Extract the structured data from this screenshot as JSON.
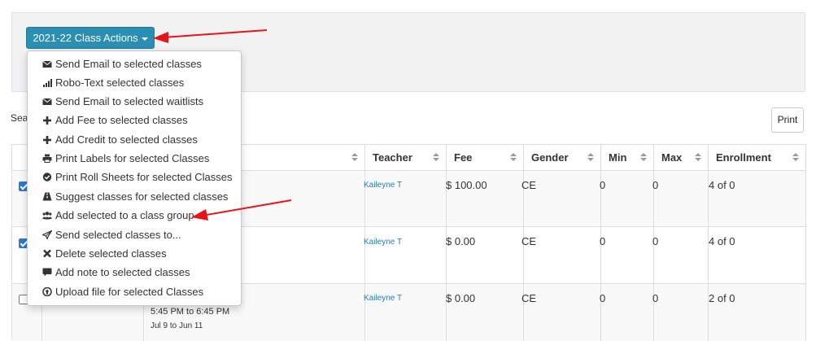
{
  "class_actions": {
    "button_label": "2021-22 Class Actions",
    "menu": [
      {
        "icon": "envelope-icon",
        "label": "Send Email to selected classes"
      },
      {
        "icon": "signal-icon",
        "label": "Robo-Text selected classes"
      },
      {
        "icon": "envelope-icon",
        "label": "Send Email to selected waitlists"
      },
      {
        "icon": "plus-icon",
        "label": "Add Fee to selected classes"
      },
      {
        "icon": "plus-icon",
        "label": "Add Credit to selected classes"
      },
      {
        "icon": "print-icon",
        "label": "Print Labels for selected Classes"
      },
      {
        "icon": "check-circle-icon",
        "label": "Print Roll Sheets for selected Classes"
      },
      {
        "icon": "road-icon",
        "label": "Suggest classes for selected classes"
      },
      {
        "icon": "users-icon",
        "label": "Add selected to a class group"
      },
      {
        "icon": "paper-plane-icon",
        "label": "Send selected classes to..."
      },
      {
        "icon": "close-icon",
        "label": "Delete selected classes"
      },
      {
        "icon": "comment-icon",
        "label": "Add note to selected classes"
      },
      {
        "icon": "upload-icon",
        "label": "Upload file for selected Classes"
      }
    ]
  },
  "search_label": "Sea",
  "print_label": "Print",
  "table": {
    "columns": [
      "Teacher",
      "Fee",
      "Gender",
      "Min",
      "Max",
      "Enrollment"
    ],
    "rows": [
      {
        "checked": true,
        "teacher": "Kaileyne T",
        "fee": "$ 100.00",
        "gender": "CE",
        "min": "0",
        "max": "0",
        "enrollment": "4 of 0",
        "time": "",
        "dates": ""
      },
      {
        "checked": true,
        "teacher": "Kaileyne T",
        "fee": "$ 0.00",
        "gender": "CE",
        "min": "0",
        "max": "0",
        "enrollment": "4 of 0",
        "time": "",
        "dates": ""
      },
      {
        "checked": false,
        "teacher": "Kaileyne T",
        "fee": "$ 0.00",
        "gender": "CE",
        "min": "0",
        "max": "0",
        "enrollment": "2 of 0",
        "time": "5:45 PM to 6:45 PM",
        "dates": "Jul 9 to Jun 11"
      }
    ]
  },
  "colors": {
    "primary": "#2a8fb3",
    "link": "#2a7bb8",
    "annotation_arrow": "#e8141c"
  }
}
